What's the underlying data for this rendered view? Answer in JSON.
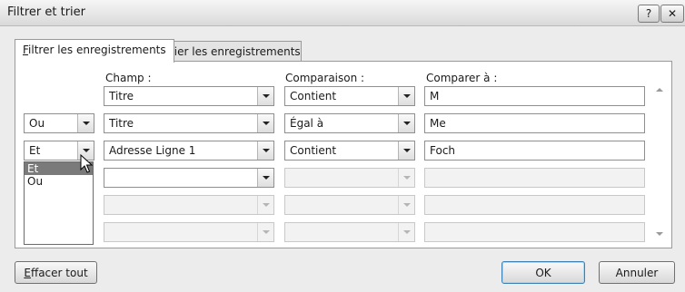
{
  "window": {
    "title": "Filtrer et trier",
    "help_label": "?",
    "close_label": "✕"
  },
  "tabs": [
    {
      "label_underlined": "F",
      "label_rest": "iltrer les enregistrements",
      "active": true
    },
    {
      "label": "Trier les enregistrements",
      "active": false
    }
  ],
  "headers": {
    "field": "Champ :",
    "comparison": "Comparaison :",
    "compare_to": "Comparer à :"
  },
  "rows": [
    {
      "operator": "",
      "field": "Titre",
      "comparison": "Contient",
      "value": "M"
    },
    {
      "operator": "Ou",
      "field": "Titre",
      "comparison": "Égal à",
      "value": "Me"
    },
    {
      "operator": "Et",
      "field": "Adresse Ligne 1",
      "comparison": "Contient",
      "value": "Foch"
    },
    {
      "operator": "",
      "field": "",
      "comparison": "",
      "value": ""
    },
    {
      "operator": "",
      "field": "",
      "comparison": "",
      "value": ""
    },
    {
      "operator": "",
      "field": "",
      "comparison": "",
      "value": ""
    }
  ],
  "operator_dropdown": {
    "options": [
      "Et",
      "Ou"
    ],
    "selected": "Et"
  },
  "buttons": {
    "clear_underlined": "E",
    "clear_rest": "ffacer tout",
    "ok": "OK",
    "cancel": "Annuler"
  }
}
